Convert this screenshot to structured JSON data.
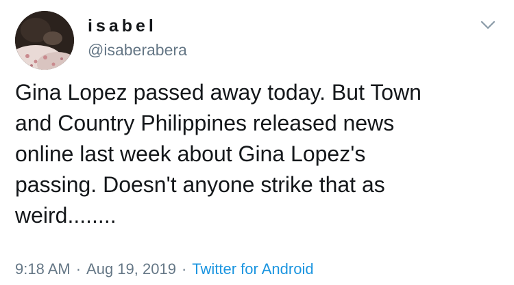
{
  "tweet": {
    "display_name": "isabel",
    "handle": "@isaberabera",
    "text": "Gina Lopez passed away today. But Town\nand Country Philippines released news\nonline last week about Gina Lopez's\npassing. Doesn't anyone strike that as\nweird........",
    "time": "9:18 AM",
    "separator": "·",
    "date": "Aug 19, 2019",
    "source": "Twitter for Android"
  },
  "icons": {
    "menu": "chevron-down-icon",
    "avatar": "avatar"
  },
  "colors": {
    "text_primary": "#14171a",
    "text_secondary": "#657786",
    "link": "#1b95e0",
    "background": "#ffffff"
  }
}
